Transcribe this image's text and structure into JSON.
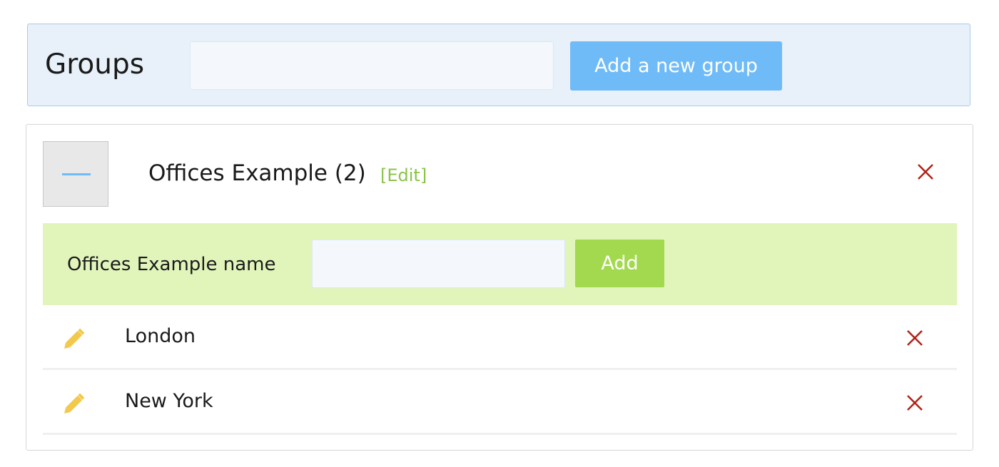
{
  "header": {
    "title": "Groups",
    "new_group_input_value": "",
    "add_group_label": "Add a new group"
  },
  "group": {
    "title": "Offices Example (2)",
    "edit_label": "[Edit]",
    "collapse_icon": "minus-icon",
    "delete_icon": "close-icon",
    "add_row": {
      "label": "Offices Example name",
      "input_value": "",
      "add_label": "Add"
    },
    "items": [
      {
        "label": "London",
        "edit_icon": "pencil-icon",
        "delete_icon": "close-icon"
      },
      {
        "label": "New York",
        "edit_icon": "pencil-icon",
        "delete_icon": "close-icon"
      }
    ]
  },
  "colors": {
    "header_bg": "#e8f0f9",
    "primary_button": "#6fbbf8",
    "add_row_bg": "#e1f5bb",
    "add_button": "#a2d94e",
    "edit_link": "#8bc34a",
    "delete_icon": "#b02418",
    "pencil_icon": "#f2c94c"
  }
}
